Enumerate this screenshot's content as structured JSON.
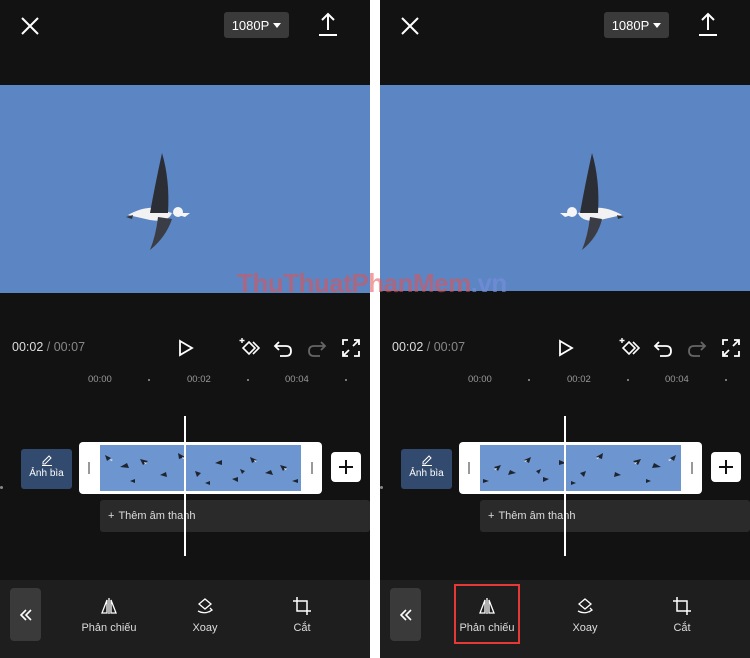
{
  "resolution": "1080P",
  "playback": {
    "current": "00:02",
    "separator": "/",
    "duration": "00:07"
  },
  "ruler": [
    "00:00",
    "00:02",
    "00:04"
  ],
  "cover_label": "Ảnh bìa",
  "audio_label": "Thêm âm thanh",
  "tools": {
    "mirror": "Phản chiếu",
    "rotate": "Xoay",
    "crop": "Cắt"
  },
  "watermark": {
    "main": "ThuThuatPhanMem",
    "suffix": ".vn"
  },
  "icons": [
    "close-icon",
    "export-icon",
    "play-icon",
    "keyframe-icon",
    "undo-icon",
    "redo-icon",
    "fullscreen-icon",
    "pencil-icon",
    "plus-icon",
    "double-chevron-left-icon",
    "mirror-icon",
    "rotate-icon",
    "crop-icon"
  ],
  "colors": {
    "sky": "#5b85c3",
    "highlight": "#e53935",
    "background": "#121212"
  }
}
